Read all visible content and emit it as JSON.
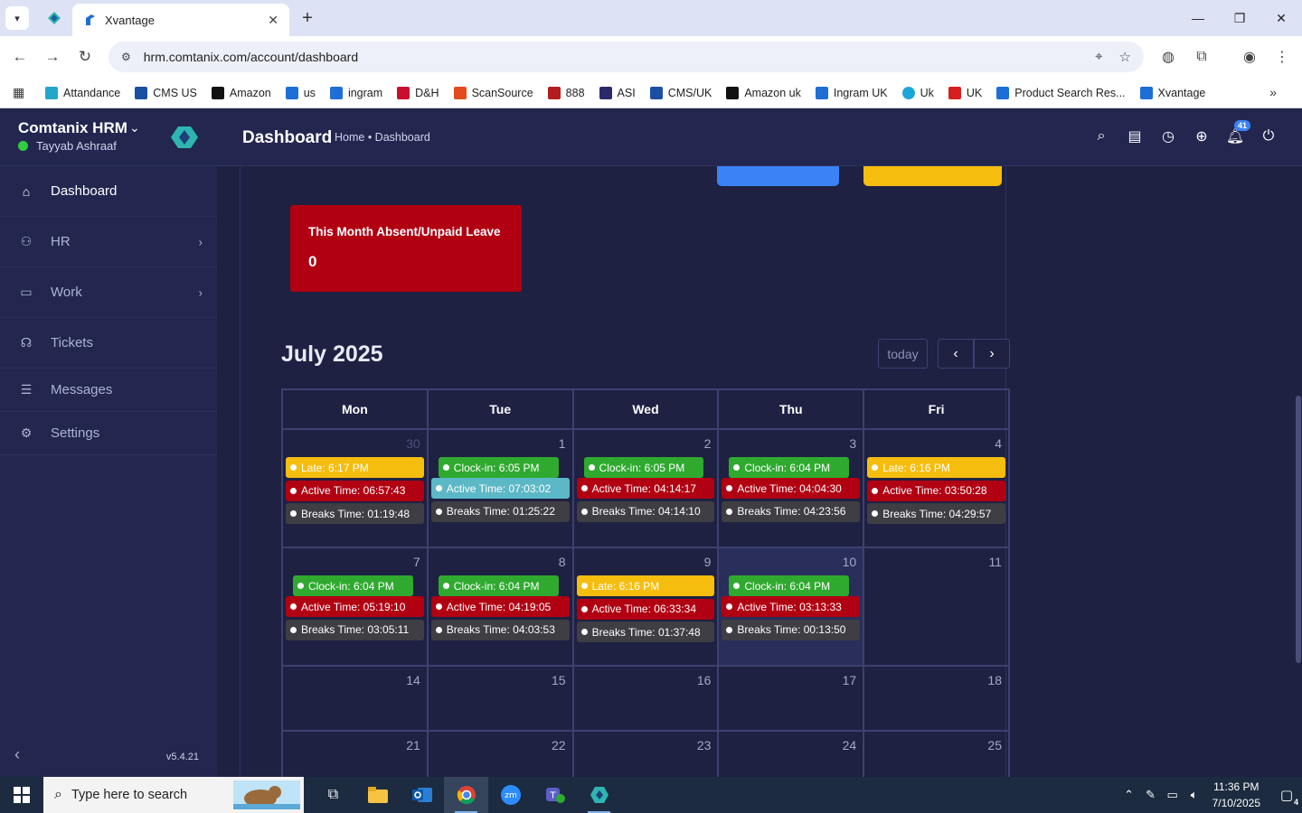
{
  "browser": {
    "tab_title": "Xvantage",
    "url": "hrm.comtanix.com/account/dashboard",
    "bookmarks": [
      {
        "label": "Attandance",
        "color": "#23a6c9"
      },
      {
        "label": "CMS US",
        "color": "#1a4fa3"
      },
      {
        "label": "Amazon",
        "color": "#111111"
      },
      {
        "label": "us",
        "color": "#1d6fd6"
      },
      {
        "label": "ingram",
        "color": "#1d6fd6"
      },
      {
        "label": "D&H",
        "color": "#c8102e"
      },
      {
        "label": "ScanSource",
        "color": "#e24a1b"
      },
      {
        "label": "888",
        "color": "#b31d1d"
      },
      {
        "label": "ASI",
        "color": "#2a2a6a"
      },
      {
        "label": "CMS/UK",
        "color": "#1a4fa3"
      },
      {
        "label": "Amazon uk",
        "color": "#111111"
      },
      {
        "label": "Ingram UK",
        "color": "#1d6fd6"
      },
      {
        "label": "Uk",
        "color": "#1ca6d8"
      },
      {
        "label": "UK",
        "color": "#d6201f"
      },
      {
        "label": "Product Search Res...",
        "color": "#1d6fd6"
      },
      {
        "label": "Xvantage",
        "color": "#1d6fd6"
      }
    ]
  },
  "sidebar": {
    "brand": "Comtanix HRM",
    "user": "Tayyab Ashraaf",
    "items": [
      {
        "label": "Dashboard",
        "icon": "home-icon"
      },
      {
        "label": "HR",
        "icon": "users-icon"
      },
      {
        "label": "Work",
        "icon": "briefcase-icon"
      },
      {
        "label": "Tickets",
        "icon": "headset-icon"
      },
      {
        "label": "Messages",
        "icon": "message-icon"
      },
      {
        "label": "Settings",
        "icon": "gear-icon"
      }
    ],
    "version": "v5.4.21"
  },
  "header": {
    "title": "Dashboard",
    "breadcrumb": "Home • Dashboard",
    "notification_count": "41"
  },
  "absent_card": {
    "title": "This Month Absent/Unpaid Leave",
    "value": "0"
  },
  "calendar": {
    "title": "July 2025",
    "today_label": "today",
    "days": [
      "Mon",
      "Tue",
      "Wed",
      "Thu",
      "Fri"
    ],
    "weeks": [
      [
        {
          "num": "30",
          "muted": true,
          "events": [
            [
              "late",
              "Late: 6:17 PM"
            ],
            [
              "active",
              "Active Time: 06:57:43"
            ],
            [
              "breaks",
              "Breaks Time: 01:19:48"
            ]
          ]
        },
        {
          "num": "1",
          "events": [
            [
              "clock",
              "Clock-in: 6:05 PM"
            ],
            [
              "active2",
              "Active Time: 07:03:02"
            ],
            [
              "breaks",
              "Breaks Time: 01:25:22"
            ]
          ]
        },
        {
          "num": "2",
          "events": [
            [
              "clock",
              "Clock-in: 6:05 PM"
            ],
            [
              "active",
              "Active Time: 04:14:17"
            ],
            [
              "breaks",
              "Breaks Time: 04:14:10"
            ]
          ]
        },
        {
          "num": "3",
          "events": [
            [
              "clock",
              "Clock-in: 6:04 PM"
            ],
            [
              "active",
              "Active Time: 04:04:30"
            ],
            [
              "breaks",
              "Breaks Time: 04:23:56"
            ]
          ]
        },
        {
          "num": "4",
          "events": [
            [
              "late",
              "Late: 6:16 PM"
            ],
            [
              "active",
              "Active Time: 03:50:28"
            ],
            [
              "breaks",
              "Breaks Time: 04:29:57"
            ]
          ]
        }
      ],
      [
        {
          "num": "7",
          "events": [
            [
              "clock",
              "Clock-in: 6:04 PM"
            ],
            [
              "active",
              "Active Time: 05:19:10"
            ],
            [
              "breaks",
              "Breaks Time: 03:05:11"
            ]
          ]
        },
        {
          "num": "8",
          "events": [
            [
              "clock",
              "Clock-in: 6:04 PM"
            ],
            [
              "active",
              "Active Time: 04:19:05"
            ],
            [
              "breaks",
              "Breaks Time: 04:03:53"
            ]
          ]
        },
        {
          "num": "9",
          "events": [
            [
              "late",
              "Late: 6:16 PM"
            ],
            [
              "active",
              "Active Time: 06:33:34"
            ],
            [
              "breaks",
              "Breaks Time: 01:37:48"
            ]
          ]
        },
        {
          "num": "10",
          "today": true,
          "events": [
            [
              "clock",
              "Clock-in: 6:04 PM"
            ],
            [
              "active",
              "Active Time: 03:13:33"
            ],
            [
              "breaks",
              "Breaks Time: 00:13:50"
            ]
          ]
        },
        {
          "num": "11",
          "events": []
        }
      ],
      [
        {
          "num": "14",
          "events": []
        },
        {
          "num": "15",
          "events": []
        },
        {
          "num": "16",
          "events": []
        },
        {
          "num": "17",
          "events": []
        },
        {
          "num": "18",
          "events": []
        }
      ],
      [
        {
          "num": "21",
          "events": []
        },
        {
          "num": "22",
          "events": []
        },
        {
          "num": "23",
          "events": []
        },
        {
          "num": "24",
          "events": []
        },
        {
          "num": "25",
          "events": []
        }
      ]
    ]
  },
  "taskbar": {
    "search_placeholder": "Type here to search",
    "time": "11:36 PM",
    "date": "7/10/2025",
    "notification_count": "4"
  }
}
